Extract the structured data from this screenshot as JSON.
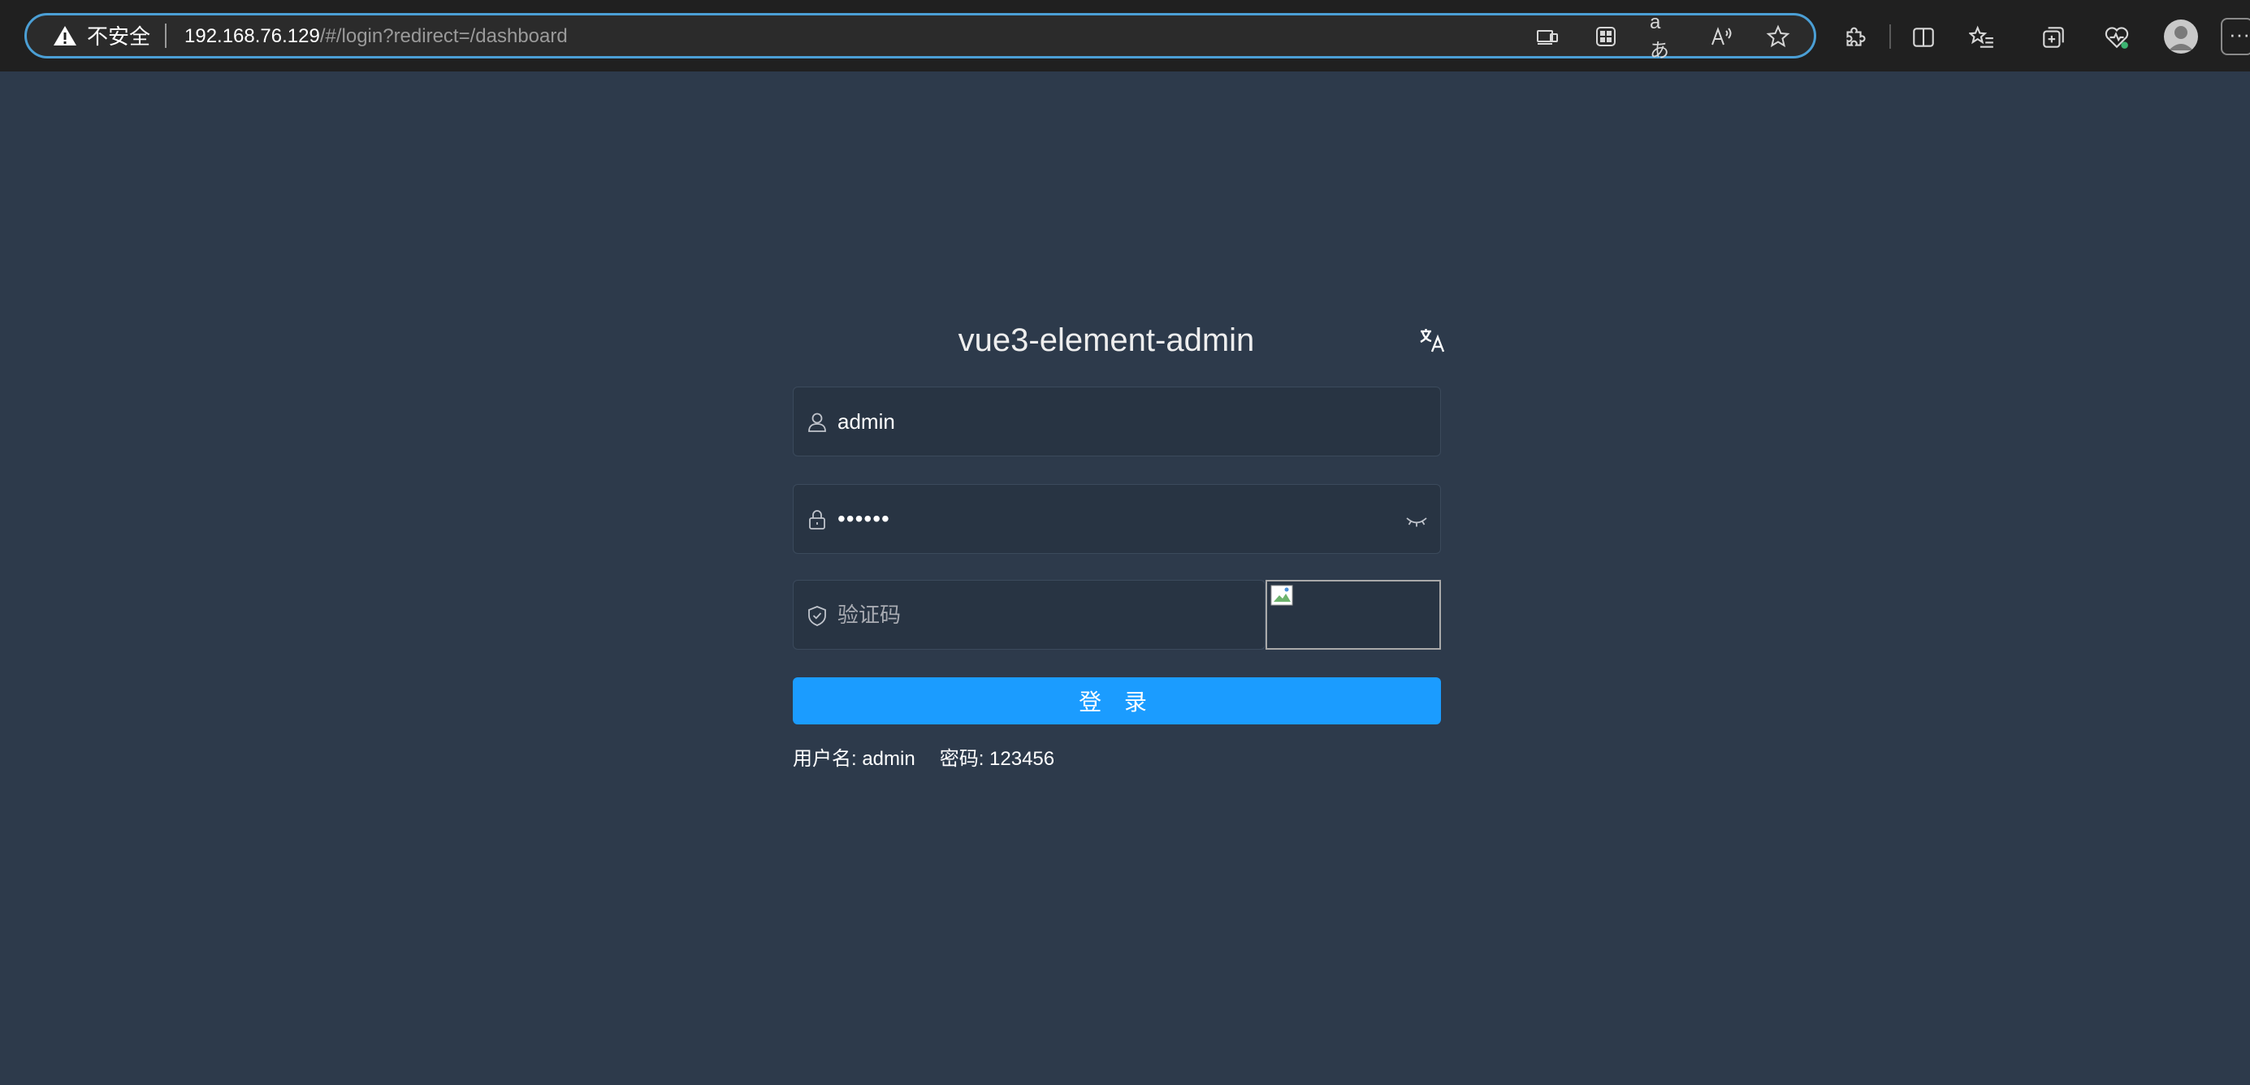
{
  "browser": {
    "security_label": "不安全",
    "url_host": "192.168.76.129",
    "url_path": "/#/login?redirect=/dashboard",
    "read_aloud_label": "aあ",
    "more_label": "···"
  },
  "login": {
    "title": "vue3-element-admin",
    "username_value": "admin",
    "password_value": "••••••",
    "captcha_placeholder": "验证码",
    "login_button": "登 录",
    "tip_username": "用户名: admin",
    "tip_password": "密码: 123456"
  },
  "colors": {
    "page_background": "#2d3a4b",
    "input_background": "#283443",
    "primary_button": "#1b9cff",
    "address_bar_focus": "#4b9fd5"
  },
  "icons": {
    "security": "warning-triangle-icon",
    "language": "translate-icon",
    "username": "user-icon",
    "password": "lock-icon",
    "password_toggle": "eye-closed-icon",
    "captcha": "shield-icon"
  }
}
